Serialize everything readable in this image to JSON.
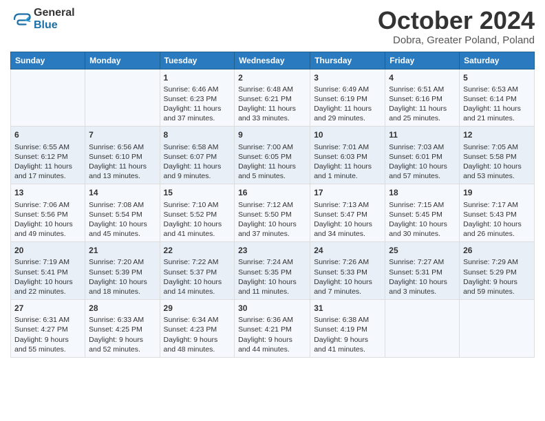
{
  "logo": {
    "general": "General",
    "blue": "Blue"
  },
  "title": {
    "month_year": "October 2024",
    "location": "Dobra, Greater Poland, Poland"
  },
  "headers": [
    "Sunday",
    "Monday",
    "Tuesday",
    "Wednesday",
    "Thursday",
    "Friday",
    "Saturday"
  ],
  "weeks": [
    [
      {
        "day": "",
        "content": ""
      },
      {
        "day": "",
        "content": ""
      },
      {
        "day": "1",
        "content": "Sunrise: 6:46 AM\nSunset: 6:23 PM\nDaylight: 11 hours and 37 minutes."
      },
      {
        "day": "2",
        "content": "Sunrise: 6:48 AM\nSunset: 6:21 PM\nDaylight: 11 hours and 33 minutes."
      },
      {
        "day": "3",
        "content": "Sunrise: 6:49 AM\nSunset: 6:19 PM\nDaylight: 11 hours and 29 minutes."
      },
      {
        "day": "4",
        "content": "Sunrise: 6:51 AM\nSunset: 6:16 PM\nDaylight: 11 hours and 25 minutes."
      },
      {
        "day": "5",
        "content": "Sunrise: 6:53 AM\nSunset: 6:14 PM\nDaylight: 11 hours and 21 minutes."
      }
    ],
    [
      {
        "day": "6",
        "content": "Sunrise: 6:55 AM\nSunset: 6:12 PM\nDaylight: 11 hours and 17 minutes."
      },
      {
        "day": "7",
        "content": "Sunrise: 6:56 AM\nSunset: 6:10 PM\nDaylight: 11 hours and 13 minutes."
      },
      {
        "day": "8",
        "content": "Sunrise: 6:58 AM\nSunset: 6:07 PM\nDaylight: 11 hours and 9 minutes."
      },
      {
        "day": "9",
        "content": "Sunrise: 7:00 AM\nSunset: 6:05 PM\nDaylight: 11 hours and 5 minutes."
      },
      {
        "day": "10",
        "content": "Sunrise: 7:01 AM\nSunset: 6:03 PM\nDaylight: 11 hours and 1 minute."
      },
      {
        "day": "11",
        "content": "Sunrise: 7:03 AM\nSunset: 6:01 PM\nDaylight: 10 hours and 57 minutes."
      },
      {
        "day": "12",
        "content": "Sunrise: 7:05 AM\nSunset: 5:58 PM\nDaylight: 10 hours and 53 minutes."
      }
    ],
    [
      {
        "day": "13",
        "content": "Sunrise: 7:06 AM\nSunset: 5:56 PM\nDaylight: 10 hours and 49 minutes."
      },
      {
        "day": "14",
        "content": "Sunrise: 7:08 AM\nSunset: 5:54 PM\nDaylight: 10 hours and 45 minutes."
      },
      {
        "day": "15",
        "content": "Sunrise: 7:10 AM\nSunset: 5:52 PM\nDaylight: 10 hours and 41 minutes."
      },
      {
        "day": "16",
        "content": "Sunrise: 7:12 AM\nSunset: 5:50 PM\nDaylight: 10 hours and 37 minutes."
      },
      {
        "day": "17",
        "content": "Sunrise: 7:13 AM\nSunset: 5:47 PM\nDaylight: 10 hours and 34 minutes."
      },
      {
        "day": "18",
        "content": "Sunrise: 7:15 AM\nSunset: 5:45 PM\nDaylight: 10 hours and 30 minutes."
      },
      {
        "day": "19",
        "content": "Sunrise: 7:17 AM\nSunset: 5:43 PM\nDaylight: 10 hours and 26 minutes."
      }
    ],
    [
      {
        "day": "20",
        "content": "Sunrise: 7:19 AM\nSunset: 5:41 PM\nDaylight: 10 hours and 22 minutes."
      },
      {
        "day": "21",
        "content": "Sunrise: 7:20 AM\nSunset: 5:39 PM\nDaylight: 10 hours and 18 minutes."
      },
      {
        "day": "22",
        "content": "Sunrise: 7:22 AM\nSunset: 5:37 PM\nDaylight: 10 hours and 14 minutes."
      },
      {
        "day": "23",
        "content": "Sunrise: 7:24 AM\nSunset: 5:35 PM\nDaylight: 10 hours and 11 minutes."
      },
      {
        "day": "24",
        "content": "Sunrise: 7:26 AM\nSunset: 5:33 PM\nDaylight: 10 hours and 7 minutes."
      },
      {
        "day": "25",
        "content": "Sunrise: 7:27 AM\nSunset: 5:31 PM\nDaylight: 10 hours and 3 minutes."
      },
      {
        "day": "26",
        "content": "Sunrise: 7:29 AM\nSunset: 5:29 PM\nDaylight: 9 hours and 59 minutes."
      }
    ],
    [
      {
        "day": "27",
        "content": "Sunrise: 6:31 AM\nSunset: 4:27 PM\nDaylight: 9 hours and 55 minutes."
      },
      {
        "day": "28",
        "content": "Sunrise: 6:33 AM\nSunset: 4:25 PM\nDaylight: 9 hours and 52 minutes."
      },
      {
        "day": "29",
        "content": "Sunrise: 6:34 AM\nSunset: 4:23 PM\nDaylight: 9 hours and 48 minutes."
      },
      {
        "day": "30",
        "content": "Sunrise: 6:36 AM\nSunset: 4:21 PM\nDaylight: 9 hours and 44 minutes."
      },
      {
        "day": "31",
        "content": "Sunrise: 6:38 AM\nSunset: 4:19 PM\nDaylight: 9 hours and 41 minutes."
      },
      {
        "day": "",
        "content": ""
      },
      {
        "day": "",
        "content": ""
      }
    ]
  ]
}
